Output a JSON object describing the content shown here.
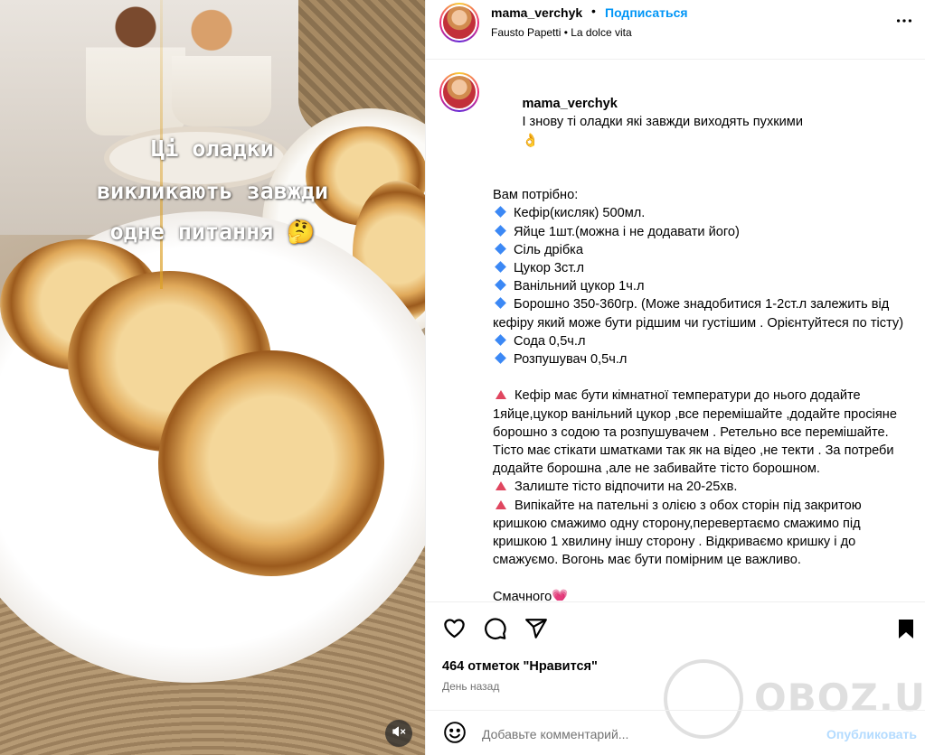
{
  "media": {
    "overlay_lines": [
      "Ці оладки",
      "викликають завжди",
      "одне питання 🤔"
    ]
  },
  "header": {
    "username": "mama_verchyk",
    "separator": "•",
    "follow_label": "Подписаться",
    "music": "Fausto Papetti • La dolce vita"
  },
  "caption": {
    "username": "mama_verchyk",
    "intro": "І знову ті оладки які завжди виходять пухкими",
    "intro_emoji": "👌",
    "need_title": "Вам потрібно:",
    "ingredients": [
      "Кефір(кисляк) 500мл.",
      "Яйце 1шт.(можна і не додавати його)",
      "Сіль дрібка",
      "Цукор 3ст.л",
      "Ванільний цукор 1ч.л",
      "Борошно 350-360гр. (Може знадобитися 1-2ст.л залежить від кефіру який може бути рідшим чи густішим . Орієнтуйтеся по тісту)",
      "Сода 0,5ч.л",
      "Розпушувач 0,5ч.л"
    ],
    "steps": [
      "Кефір має бути кімнатної температури до нього додайте 1яйце,цукор ванільний цукор ,все перемішайте ,додайте просіяне борошно з содою та розпушувачем . Ретельно все перемішайте. Тісто має стікати шматками так як на відео ,не текти . За потреби додайте борошна ,але не забивайте тісто борошном.",
      "Залиште тісто відпочити на 20-25хв.",
      "Випікайте на пательні з олією з обох сторін під закритою кришкою смажимо одну сторону,перевертаємо смажимо під кришкою 1 хвилину іншу сторону . Відкриваємо кришку і до смажуємо. Вогонь має бути помірним це важливо."
    ],
    "closing": "Смачного",
    "closing_emoji": "💗"
  },
  "stats": {
    "likes": "464 отметок \"Нравится\"",
    "time": "День назад"
  },
  "comment": {
    "placeholder": "Добавьте комментарий...",
    "publish_label": "Опубликовать"
  },
  "watermark": {
    "text": "OBOZ.UA"
  },
  "icons": {
    "like": "heart-icon",
    "comment": "comment-icon",
    "share": "share-icon",
    "save": "bookmark-icon",
    "more": "more-icon",
    "emoji": "emoji-icon",
    "mute": "muted-speaker-icon"
  },
  "colors": {
    "follow": "#0095f6",
    "publish_disabled": "#b3dbff",
    "bullet_blue": "#3b88f5",
    "bullet_red": "#e0465f"
  }
}
